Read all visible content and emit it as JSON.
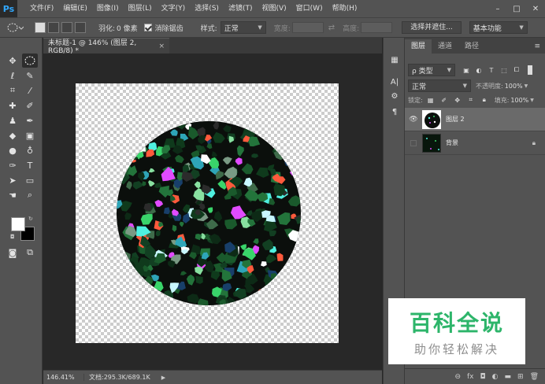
{
  "app": {
    "logo": "Ps"
  },
  "menu": [
    "文件(F)",
    "编辑(E)",
    "图像(I)",
    "图层(L)",
    "文字(Y)",
    "选择(S)",
    "滤镜(T)",
    "视图(V)",
    "窗口(W)",
    "帮助(H)"
  ],
  "window_controls": {
    "minimize": "–",
    "maximize": "□",
    "close": "✕"
  },
  "options": {
    "feather_label": "羽化:",
    "feather_value": "0 像素",
    "antialias_label": "消除锯齿",
    "antialias_checked": true,
    "style_label": "样式:",
    "style_value": "正常",
    "width_label": "宽度:",
    "height_label": "高度:",
    "swap_icon": "⇄",
    "select_mask_button": "选择并遮住...",
    "workspace_value": "基本功能"
  },
  "document": {
    "tab_title": "未标题-1 @ 146% (图层 2, RGB/8) *",
    "close_icon": "×"
  },
  "status": {
    "zoom": "146.41%",
    "doc_info": "文档:295.3K/689.1K",
    "arrow": "▶"
  },
  "panel": {
    "tabs": [
      "图层",
      "通道",
      "路径"
    ],
    "menu_icon": "≡",
    "filter_label": "ρ 类型",
    "blend_mode": "正常",
    "opacity_label": "不透明度:",
    "opacity_value": "100%",
    "lock_label": "锁定:",
    "fill_label": "填充:",
    "fill_value": "100%",
    "layers": [
      {
        "name": "图层 2",
        "visible": true,
        "selected": true,
        "locked": false
      },
      {
        "name": "背景",
        "visible": false,
        "selected": false,
        "locked": true
      }
    ]
  },
  "watermark": {
    "title": "百科全说",
    "subtitle": "助你轻松解决",
    "title_color": "#2db56a"
  },
  "colors": {
    "foreground": "#ffffff",
    "background": "#000000",
    "accent": "#31a8ff"
  }
}
